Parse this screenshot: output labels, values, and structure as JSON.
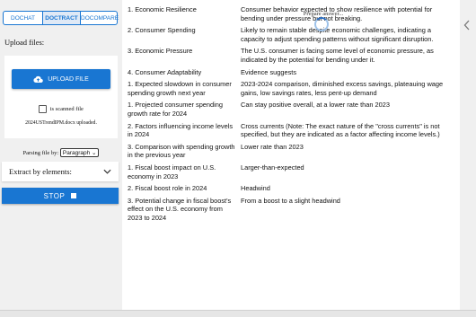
{
  "tabs": [
    "DOCHAT",
    "DOCTRACT",
    "DOCOMPARE"
  ],
  "upload": {
    "label": "Upload files:",
    "button": "UPLOAD FILE",
    "scanned_label": "is scanned file",
    "uploaded_text": "2024USTrendIPM.docx uploaded."
  },
  "parsing": {
    "label": "Parsing file by:",
    "value": "Paragraph"
  },
  "extract": {
    "label": "Extract by elements:"
  },
  "stop": {
    "label": "STOP"
  },
  "overlay": {
    "text": "Prepare answer..."
  },
  "rows": [
    {
      "key": "1. Economic Resilience",
      "value": "Consumer behavior expected to show resilience with potential for bending under pressure but not breaking."
    },
    {
      "key": "2. Consumer Spending",
      "value": "Likely to remain stable despite economic challenges, indicating a capacity to adjust spending patterns without significant disruption."
    },
    {
      "key": "3. Economic Pressure",
      "value": "The U.S. consumer is facing some level of economic pressure, as indicated by the potential for bending under it."
    },
    {
      "key": "4. Consumer Adaptability",
      "value": "Evidence suggests"
    },
    {
      "key": "1. Expected slowdown in consumer spending growth next year",
      "value": "2023-2024 comparison, diminished excess savings, plateauing wage gains, low savings rates, less pent-up demand"
    },
    {
      "key": "1. Projected consumer spending growth rate for 2024",
      "value": "Can stay positive overall, at a lower rate than 2023"
    },
    {
      "key": "2. Factors influencing income levels in 2024",
      "value": "Cross currents (Note: The exact nature of the \"cross currents\" is not specified, but they are indicated as a factor affecting income levels.)"
    },
    {
      "key": "3. Comparison with spending growth in the previous year",
      "value": "Lower rate than 2023"
    },
    {
      "key": "1. Fiscal boost impact on U.S. economy in 2023",
      "value": "Larger-than-expected"
    },
    {
      "key": "2. Fiscal boost role in 2024",
      "value": "Headwind"
    },
    {
      "key": "3. Potential change in fiscal boost's effect on the U.S. economy from 2023 to 2024",
      "value": "From a boost to a slight headwind"
    }
  ]
}
